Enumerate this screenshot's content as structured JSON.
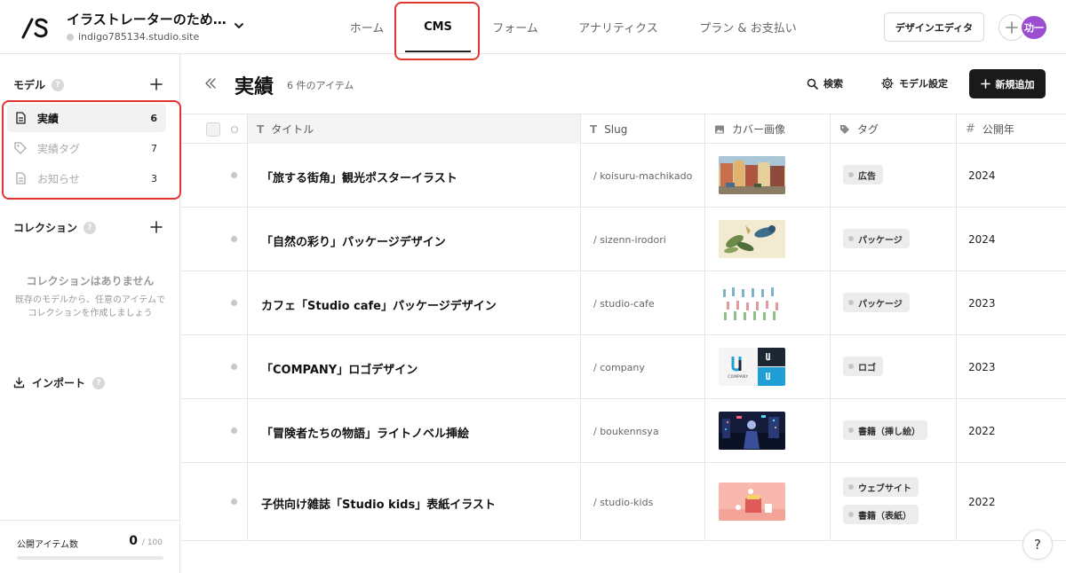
{
  "header": {
    "site_title": "イラストレーターのため…",
    "site_url": "indigo785134.studio.site",
    "tabs": [
      "ホーム",
      "CMS",
      "フォーム",
      "アナリティクス",
      "プラン & お支払い"
    ],
    "design_editor_label": "デザインエディタ",
    "avatar_text": "功一"
  },
  "sidebar": {
    "models_heading": "モデル",
    "models": [
      {
        "label": "実績",
        "count": "6",
        "icon": "document-icon"
      },
      {
        "label": "実績タグ",
        "count": "7",
        "icon": "tag-icon"
      },
      {
        "label": "お知らせ",
        "count": "3",
        "icon": "document-icon"
      }
    ],
    "collections_heading": "コレクション",
    "collections_empty_title": "コレクションはありません",
    "collections_empty_desc_1": "既存のモデルから、任意のアイテムで",
    "collections_empty_desc_2": "コレクションを作成しましょう",
    "import_label": "インポート",
    "published_label": "公開アイテム数",
    "published_value": "0",
    "published_max": "/ 100",
    "published_fraction": 0
  },
  "main": {
    "title": "実績",
    "item_count": "6 件のアイテム",
    "search_label": "検索",
    "model_settings_label": "モデル設定",
    "new_label": "新規追加"
  },
  "table": {
    "columns": [
      "タイトル",
      "Slug",
      "カバー画像",
      "タグ",
      "公開年"
    ],
    "rows": [
      {
        "title": "「旅する街角」観光ポスターイラスト",
        "slug": "/ koisuru-machikado",
        "tags": [
          "広告"
        ],
        "year": "2024"
      },
      {
        "title": "「自然の彩り」パッケージデザイン",
        "slug": "/ sizenn-irodori",
        "tags": [
          "パッケージ"
        ],
        "year": "2024"
      },
      {
        "title": "カフェ「Studio cafe」パッケージデザイン",
        "slug": "/ studio-cafe",
        "tags": [
          "パッケージ"
        ],
        "year": "2023"
      },
      {
        "title": "「COMPANY」ロゴデザイン",
        "slug": "/ company",
        "tags": [
          "ロゴ"
        ],
        "year": "2023"
      },
      {
        "title": "「冒険者たちの物語」ライトノベル挿絵",
        "slug": "/ boukennsya",
        "tags": [
          "書籍（挿し絵）"
        ],
        "year": "2022"
      },
      {
        "title": "子供向け雑誌「Studio kids」表紙イラスト",
        "slug": "/ studio-kids",
        "tags": [
          "ウェブサイト",
          "書籍（表紙）"
        ],
        "year": "2022"
      }
    ]
  },
  "logo_mark_text": "COMPANY",
  "help_label": "?",
  "colors": {
    "accent_red": "#e3342f",
    "avatar": "#9b4fd0",
    "primary_button": "#1a1a1a"
  }
}
